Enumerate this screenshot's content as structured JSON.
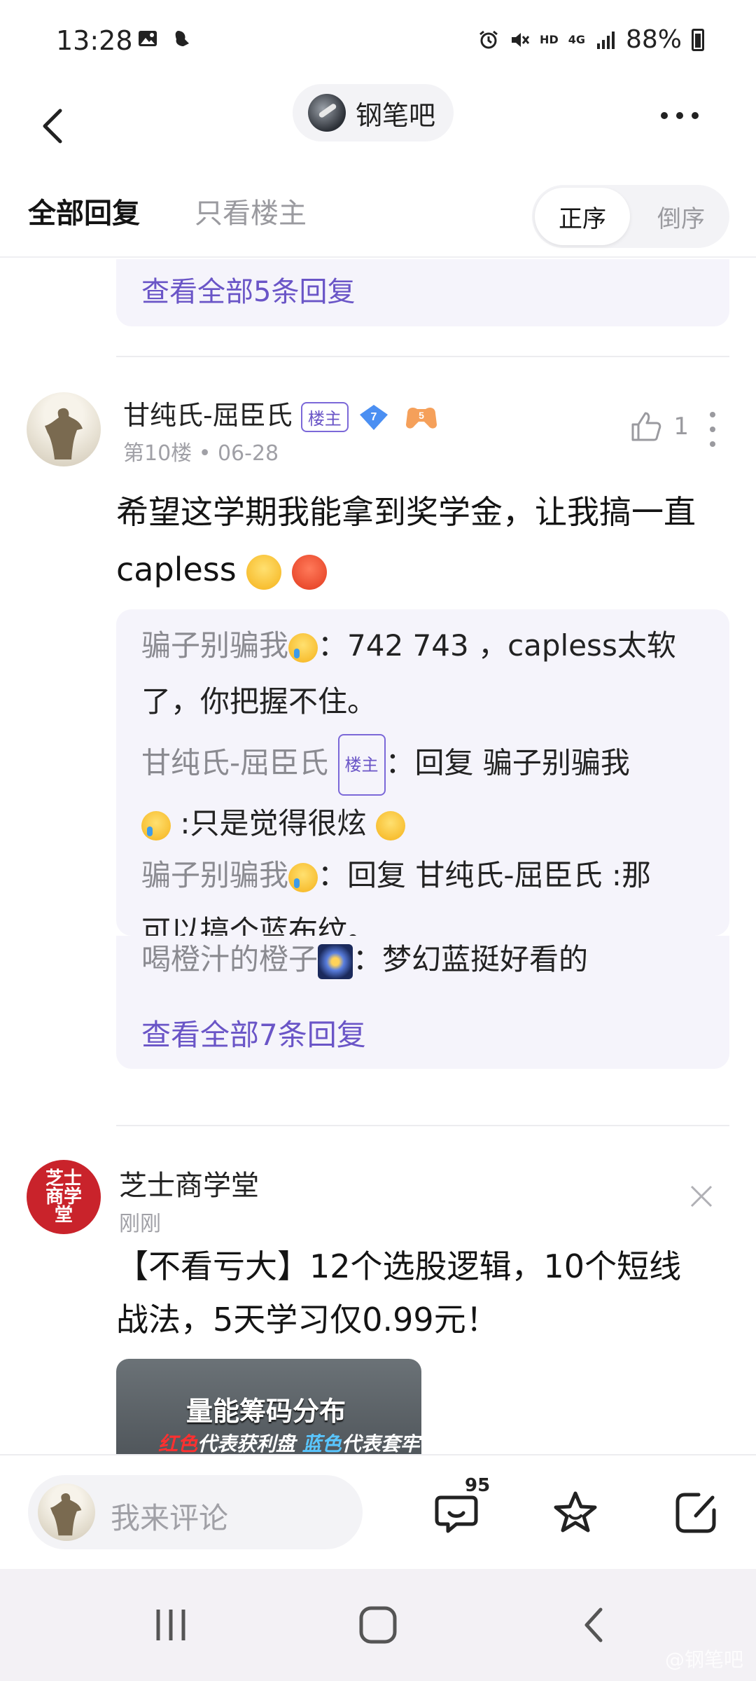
{
  "status_bar": {
    "time": "13:28",
    "network": "4G",
    "hd": "HD",
    "battery": "88%"
  },
  "nav": {
    "forum_name": "钢笔吧"
  },
  "tabs": {
    "all_replies": "全部回复",
    "op_only": "只看楼主",
    "sort_asc": "正序",
    "sort_desc": "倒序"
  },
  "prev_post": {
    "view_all": "查看全部5条回复"
  },
  "post": {
    "author": "甘纯氏-屈臣氏",
    "op_badge": "楼主",
    "level": "7",
    "level2": "5",
    "floor": "第10楼",
    "date": "06-28",
    "likes": "1",
    "text_line1": "希望这学期我能拿到奖学金，让我搞一直",
    "text_line2": "capless",
    "sub_replies": [
      {
        "user": "骗子别骗我",
        "sep": "：",
        "text_a": "742 743 ，capless太软",
        "text_b": "了，你把握不住。"
      },
      {
        "user": "甘纯氏-屈臣氏",
        "badge": "楼主",
        "sep": "：",
        "text_a": "回复 骗子别骗我",
        "text_b": " :只是觉得很炫"
      },
      {
        "user": "骗子别骗我",
        "sep": "：",
        "text_a": "回复 甘纯氏-屈臣氏 :那",
        "text_b": "可以搞个蓝布纹。"
      },
      {
        "user": "喝橙汁的橙子",
        "sep": "：",
        "text_a": "梦幻蓝挺好看的"
      }
    ],
    "view_all": "查看全部7条回复"
  },
  "ad": {
    "advertiser": "芝士商学堂",
    "logo_text": "芝士商学堂",
    "time": "刚刚",
    "text_line1": "【不看亏大】12个选股逻辑，10个短线",
    "text_line2": "战法，5天学习仅0.99元！",
    "image_title": "量能筹码分布",
    "image_sub_red": "红色",
    "image_sub_mid": "代表获利盘 ",
    "image_sub_blue": "蓝色",
    "image_sub_end": "代表套牢盘"
  },
  "action_bar": {
    "comment_placeholder": "我来评论",
    "comment_count": "95"
  },
  "watermark": "@钢笔吧",
  "colors": {
    "accent": "#6a55c7",
    "sub_box_bg": "#f5f4fb",
    "ad_logo": "#c9232b"
  }
}
